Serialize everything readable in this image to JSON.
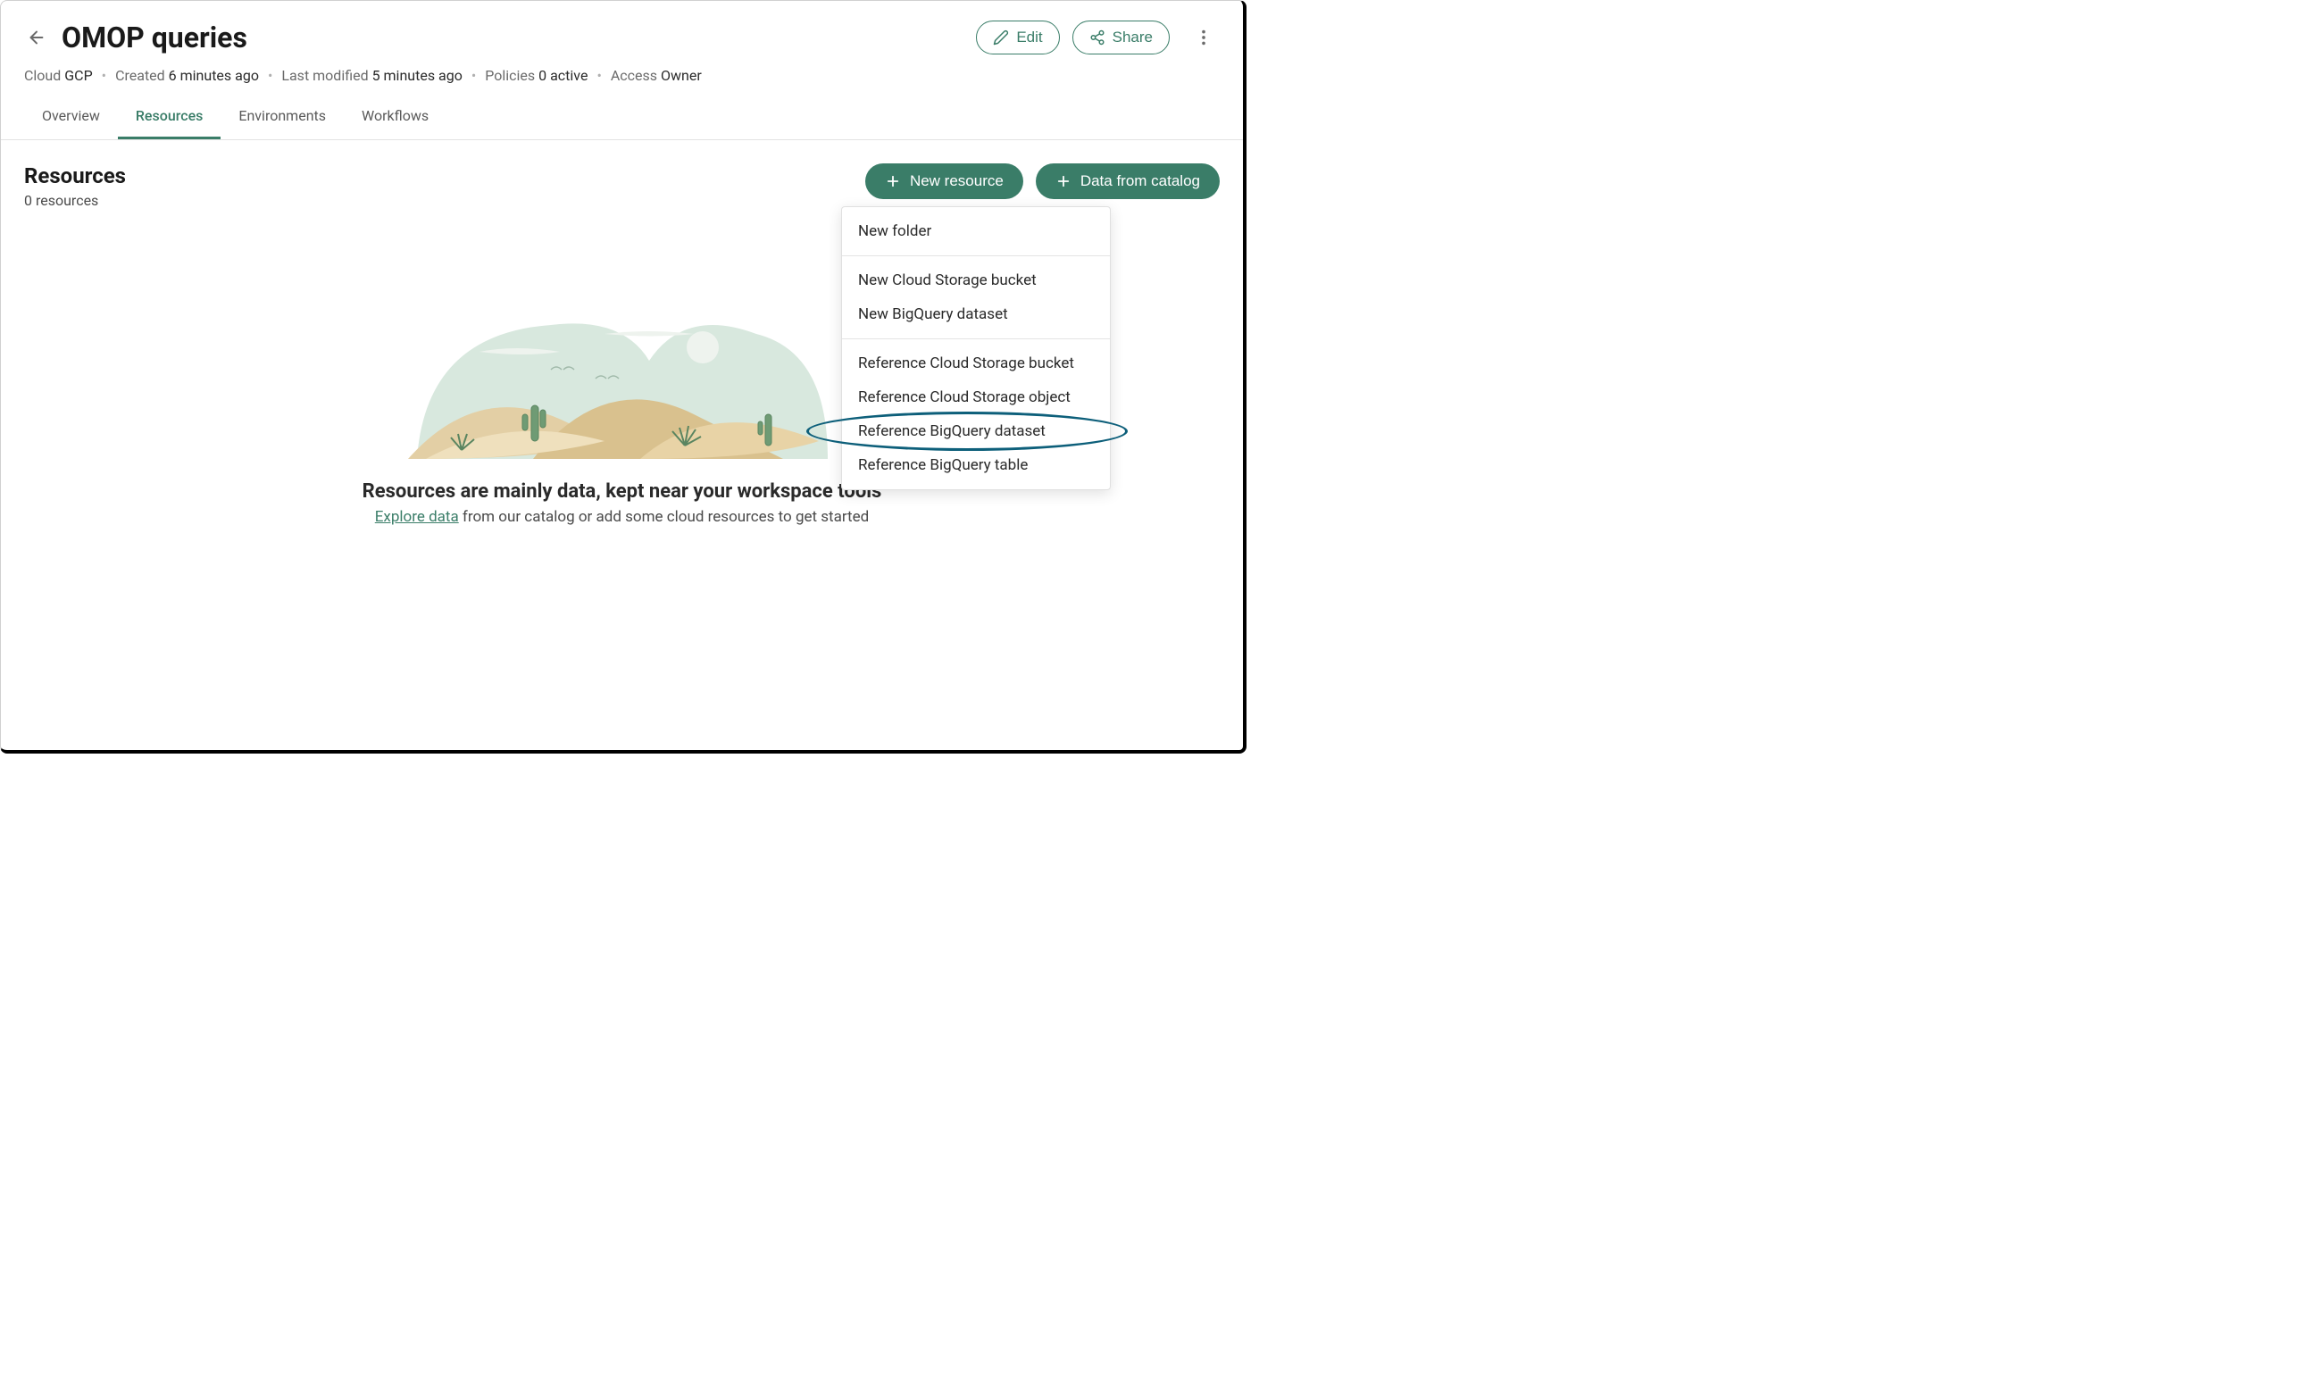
{
  "header": {
    "title": "OMOP queries",
    "edit_label": "Edit",
    "share_label": "Share"
  },
  "meta": {
    "cloud_label": "Cloud",
    "cloud_value": "GCP",
    "created_label": "Created",
    "created_value": "6 minutes ago",
    "modified_label": "Last modified",
    "modified_value": "5 minutes ago",
    "policies_label": "Policies",
    "policies_value": "0 active",
    "access_label": "Access",
    "access_value": "Owner"
  },
  "tabs": {
    "overview": "Overview",
    "resources": "Resources",
    "environments": "Environments",
    "workflows": "Workflows"
  },
  "section": {
    "title": "Resources",
    "count": "0 resources"
  },
  "buttons": {
    "new_resource": "New resource",
    "data_from_catalog": "Data from catalog"
  },
  "dropdown": {
    "new_folder": "New folder",
    "new_cloud_bucket": "New Cloud Storage bucket",
    "new_bq_dataset": "New BigQuery dataset",
    "ref_cloud_bucket": "Reference Cloud Storage bucket",
    "ref_cloud_object": "Reference Cloud Storage object",
    "ref_bq_dataset": "Reference BigQuery dataset",
    "ref_bq_table": "Reference BigQuery table"
  },
  "empty": {
    "heading": "Resources are mainly data, kept near your workspace tools",
    "link_text": "Explore data",
    "rest_text": " from our catalog or add some cloud resources to get started"
  }
}
